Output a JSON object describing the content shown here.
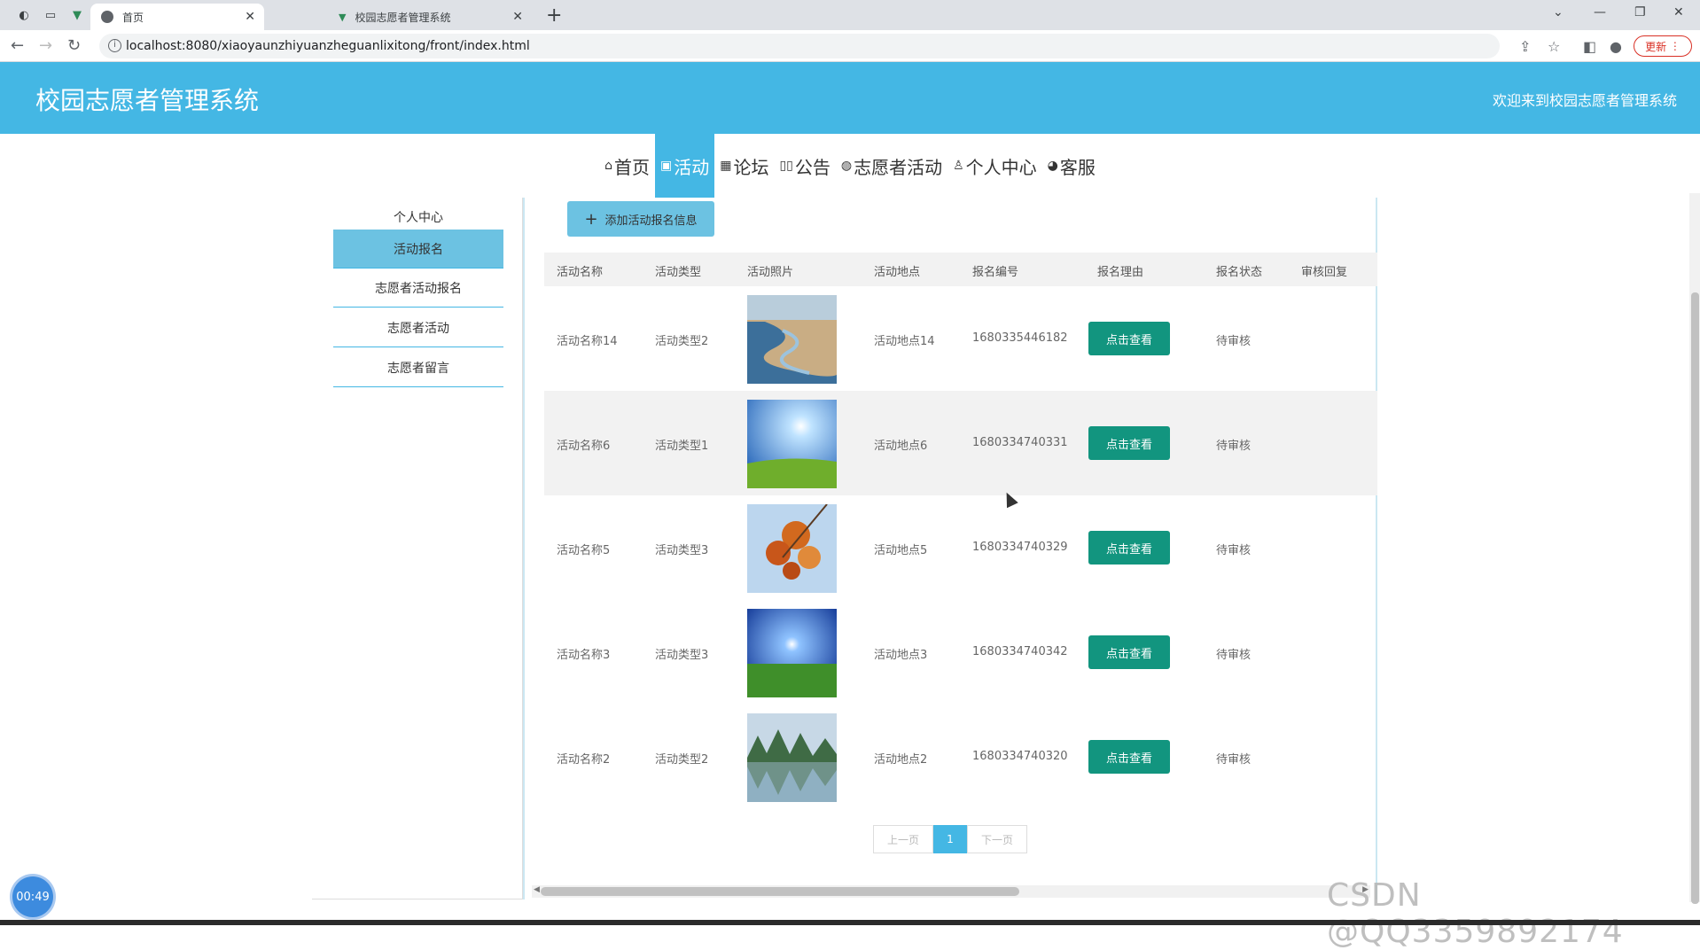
{
  "browser": {
    "tabs": [
      {
        "label": "首页",
        "active": true
      },
      {
        "label": "校园志愿者管理系统",
        "active": false
      }
    ],
    "url": "localhost:8080/xiaoyaunzhiyuanzheguanlixitong/front/index.html",
    "update_label": "更新"
  },
  "header": {
    "title": "校园志愿者管理系统",
    "welcome": "欢迎来到校园志愿者管理系统"
  },
  "nav": {
    "items": [
      {
        "label": "首页",
        "icon": "home-icon"
      },
      {
        "label": "活动",
        "icon": "gift-icon",
        "active": true
      },
      {
        "label": "论坛",
        "icon": "forum-icon"
      },
      {
        "label": "公告",
        "icon": "notice-icon"
      },
      {
        "label": "志愿者活动",
        "icon": "palette-icon"
      },
      {
        "label": "个人中心",
        "icon": "user-icon"
      },
      {
        "label": "客服",
        "icon": "service-icon"
      }
    ]
  },
  "sidebar": {
    "items": [
      {
        "label": "个人中心"
      },
      {
        "label": "活动报名",
        "active": true
      },
      {
        "label": "志愿者活动报名"
      },
      {
        "label": "志愿者活动"
      },
      {
        "label": "志愿者留言"
      }
    ]
  },
  "main": {
    "add_button": "添加活动报名信息",
    "columns": [
      "活动名称",
      "活动类型",
      "活动照片",
      "活动地点",
      "报名编号",
      "报名理由",
      "报名状态",
      "审核回复"
    ],
    "view_label": "点击查看",
    "rows": [
      {
        "name": "活动名称14",
        "type": "活动类型2",
        "place": "活动地点14",
        "no": "1680335446182",
        "status": "待审核",
        "reply": ""
      },
      {
        "name": "活动名称6",
        "type": "活动类型1",
        "place": "活动地点6",
        "no": "1680334740331",
        "status": "待审核",
        "reply": ""
      },
      {
        "name": "活动名称5",
        "type": "活动类型3",
        "place": "活动地点5",
        "no": "1680334740329",
        "status": "待审核",
        "reply": ""
      },
      {
        "name": "活动名称3",
        "type": "活动类型3",
        "place": "活动地点3",
        "no": "1680334740342",
        "status": "待审核",
        "reply": ""
      },
      {
        "name": "活动名称2",
        "type": "活动类型2",
        "place": "活动地点2",
        "no": "1680334740320",
        "status": "待审核",
        "reply": ""
      }
    ],
    "pager": {
      "prev": "上一页",
      "current": "1",
      "next": "下一页"
    }
  },
  "timer": "00:49",
  "watermark": "CSDN @QQ3359892174",
  "colors": {
    "brand": "#44b7e4",
    "button": "#12957f"
  }
}
